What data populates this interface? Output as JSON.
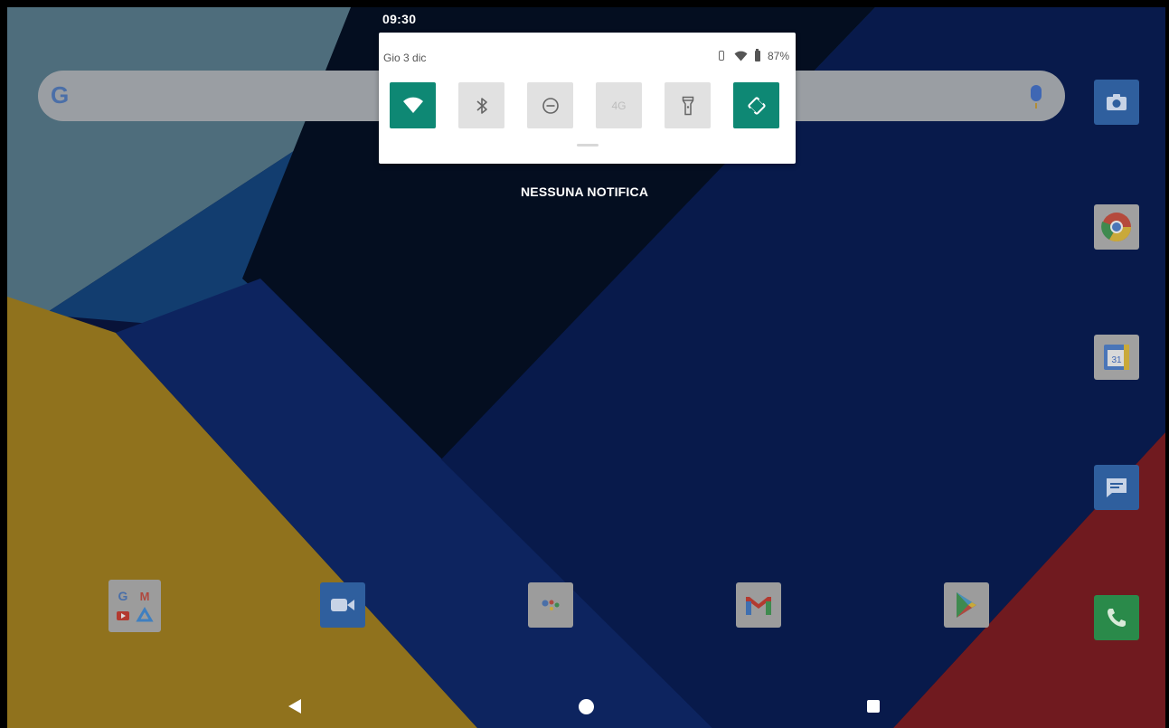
{
  "status_bar": {
    "time": "09:30"
  },
  "quick_settings": {
    "date": "Gio 3 dic",
    "battery_percent": "87%",
    "tiles": [
      {
        "name": "wifi",
        "label": "",
        "active": true
      },
      {
        "name": "bluetooth",
        "label": "",
        "active": false
      },
      {
        "name": "do-not-disturb",
        "label": "",
        "active": false
      },
      {
        "name": "mobile-data",
        "label": "4G",
        "active": false,
        "disabled": true
      },
      {
        "name": "flashlight",
        "label": "",
        "active": false
      },
      {
        "name": "auto-rotate",
        "label": "",
        "active": true
      }
    ]
  },
  "notifications": {
    "empty_text": "NESSUNA NOTIFICA"
  },
  "search_bar": {
    "logo": "G"
  },
  "colors": {
    "tile_active": "#0e8874",
    "tile_inactive": "#e1e1e1",
    "panel_bg": "#ffffff"
  },
  "home_icons": [
    "camera-icon",
    "chrome-icon",
    "calendar-icon",
    "messages-icon",
    "phone-icon",
    "google-folder-icon",
    "duo-icon",
    "assistant-icon",
    "gmail-icon",
    "play-store-icon"
  ],
  "calendar_icon_text": "31",
  "folder_letters": [
    "G",
    "M"
  ],
  "nav_bar": [
    "back-button",
    "home-button",
    "recents-button"
  ]
}
